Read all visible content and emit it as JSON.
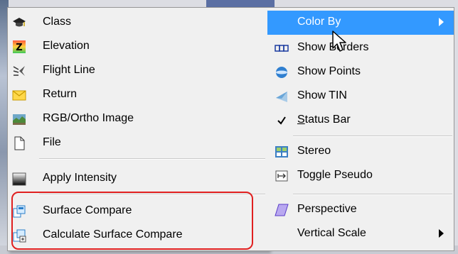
{
  "submenu": {
    "items": [
      {
        "label": "Class",
        "icon": "graduation-cap-icon"
      },
      {
        "label": "Elevation",
        "icon": "elevation-z-icon"
      },
      {
        "label": "Flight Line",
        "icon": "flight-line-icon"
      },
      {
        "label": "Return",
        "icon": "envelope-icon"
      },
      {
        "label": "RGB/Ortho Image",
        "icon": "ortho-image-icon"
      },
      {
        "label": "File",
        "icon": "file-icon"
      },
      {
        "label": "Apply Intensity",
        "icon": "intensity-gradient-icon"
      },
      {
        "label": "Surface Compare",
        "icon": "surface-compare-icon"
      },
      {
        "label": "Calculate Surface Compare",
        "icon": "calculate-surface-compare-icon"
      }
    ]
  },
  "main_menu": {
    "items": [
      {
        "label": "Color By",
        "icon": "",
        "highlighted": true,
        "has_submenu": true
      },
      {
        "label": "Show Borders",
        "icon": "borders-icon"
      },
      {
        "label": "Show Points",
        "icon": "points-sphere-icon"
      },
      {
        "label": "Show TIN",
        "icon": "tin-icon"
      },
      {
        "label": "Status Bar",
        "icon": "checkmark-icon",
        "checked": true,
        "mnemonic": "S",
        "rest": "tatus Bar"
      },
      {
        "label": "Stereo",
        "icon": "stereo-icon"
      },
      {
        "label": "Toggle Pseudo",
        "icon": "toggle-pseudo-icon"
      },
      {
        "label": "Perspective",
        "icon": "perspective-icon"
      },
      {
        "label": "Vertical Scale",
        "icon": "",
        "has_submenu": true
      }
    ]
  },
  "colors": {
    "highlight": "#3399ff",
    "menu_bg": "#f0f0f0",
    "annotation": "#e02020"
  }
}
